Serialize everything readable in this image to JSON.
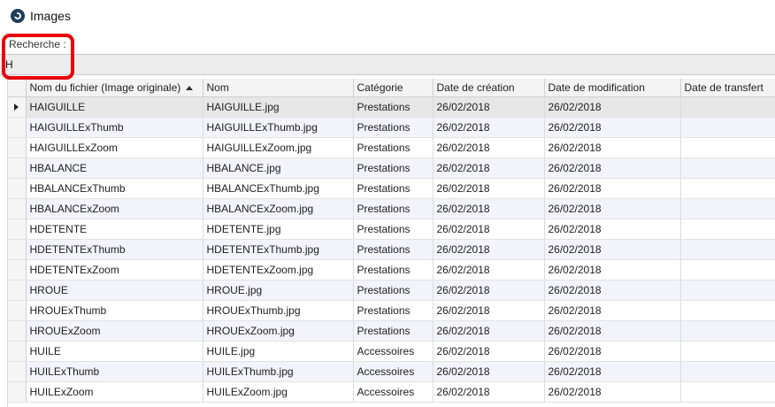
{
  "window": {
    "title": "Images",
    "icon": "app-logo-icon"
  },
  "search": {
    "label": "Recherche :",
    "value": "H"
  },
  "table": {
    "columns": [
      "Nom du fichier (Image originale)",
      "Nom",
      "Catégorie",
      "Date de création",
      "Date de modification",
      "Date de transfert"
    ],
    "sort_column": 0,
    "sort_direction": "ascending",
    "rows": [
      [
        "HAIGUILLE",
        "HAIGUILLE.jpg",
        "Prestations",
        "26/02/2018",
        "26/02/2018",
        ""
      ],
      [
        "HAIGUILLExThumb",
        "HAIGUILLExThumb.jpg",
        "Prestations",
        "26/02/2018",
        "26/02/2018",
        ""
      ],
      [
        "HAIGUILLExZoom",
        "HAIGUILLExZoom.jpg",
        "Prestations",
        "26/02/2018",
        "26/02/2018",
        ""
      ],
      [
        "HBALANCE",
        "HBALANCE.jpg",
        "Prestations",
        "26/02/2018",
        "26/02/2018",
        ""
      ],
      [
        "HBALANCExThumb",
        "HBALANCExThumb.jpg",
        "Prestations",
        "26/02/2018",
        "26/02/2018",
        ""
      ],
      [
        "HBALANCExZoom",
        "HBALANCExZoom.jpg",
        "Prestations",
        "26/02/2018",
        "26/02/2018",
        ""
      ],
      [
        "HDETENTE",
        "HDETENTE.jpg",
        "Prestations",
        "26/02/2018",
        "26/02/2018",
        ""
      ],
      [
        "HDETENTExThumb",
        "HDETENTExThumb.jpg",
        "Prestations",
        "26/02/2018",
        "26/02/2018",
        ""
      ],
      [
        "HDETENTExZoom",
        "HDETENTExZoom.jpg",
        "Prestations",
        "26/02/2018",
        "26/02/2018",
        ""
      ],
      [
        "HROUE",
        "HROUE.jpg",
        "Prestations",
        "26/02/2018",
        "26/02/2018",
        ""
      ],
      [
        "HROUExThumb",
        "HROUExThumb.jpg",
        "Prestations",
        "26/02/2018",
        "26/02/2018",
        ""
      ],
      [
        "HROUExZoom",
        "HROUExZoom.jpg",
        "Prestations",
        "26/02/2018",
        "26/02/2018",
        ""
      ],
      [
        "HUILE",
        "HUILE.jpg",
        "Accessoires",
        "26/02/2018",
        "26/02/2018",
        ""
      ],
      [
        "HUILExThumb",
        "HUILExThumb.jpg",
        "Accessoires",
        "26/02/2018",
        "26/02/2018",
        ""
      ],
      [
        "HUILExZoom",
        "HUILExZoom.jpg",
        "Accessoires",
        "26/02/2018",
        "26/02/2018",
        ""
      ]
    ],
    "selected_row": 0
  },
  "colors": {
    "highlight": "#e8000b",
    "alt_row": "#f3f3fb",
    "selected_row": "#e7e7e7"
  }
}
